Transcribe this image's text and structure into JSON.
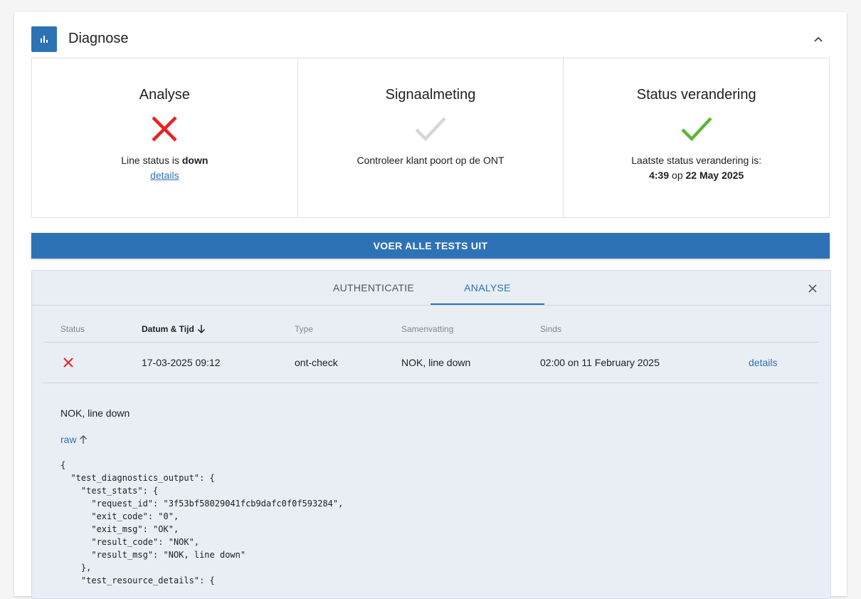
{
  "header": {
    "title": "Diagnose",
    "icon": "bar-chart-icon",
    "collapse_icon": "chevron-up-icon",
    "accent_color": "#2e72b6"
  },
  "panels": [
    {
      "title": "Analyse",
      "status_icon": "cross-icon",
      "status_color": "#e52222",
      "text_prefix": "Line status is ",
      "text_bold": "down",
      "link": "details"
    },
    {
      "title": "Signaalmeting",
      "status_icon": "check-icon",
      "status_color": "#d6d6d6",
      "text": "Controleer klant poort op de ONT"
    },
    {
      "title": "Status verandering",
      "status_icon": "check-icon",
      "status_color": "#5cb735",
      "text_line1": "Laatste status verandering is:",
      "time": "4:39",
      "text_mid": " op ",
      "date": "22 May 2025"
    }
  ],
  "run_button": {
    "label": "VOER ALLE TESTS UIT"
  },
  "tabs": [
    {
      "label": "AUTHENTICATIE",
      "active": false
    },
    {
      "label": "ANALYSE",
      "active": true
    }
  ],
  "table": {
    "headers": {
      "status": "Status",
      "datetime": "Datum & Tijd",
      "type": "Type",
      "summary": "Samenvatting",
      "since": "Sinds"
    },
    "rows": [
      {
        "status_icon": "cross-icon",
        "datetime": "17-03-2025 09:12",
        "type": "ont-check",
        "summary": "NOK, line down",
        "since": "02:00 on 11 February 2025",
        "link": "details"
      }
    ]
  },
  "detail": {
    "summary": "NOK, line down",
    "raw_label": "raw",
    "raw_json": "{\n  \"test_diagnostics_output\": {\n    \"test_stats\": {\n      \"request_id\": \"3f53bf58029041fcb9dafc0f0f593284\",\n      \"exit_code\": \"0\",\n      \"exit_msg\": \"OK\",\n      \"result_code\": \"NOK\",\n      \"result_msg\": \"NOK, line down\"\n    },\n    \"test_resource_details\": {"
  }
}
